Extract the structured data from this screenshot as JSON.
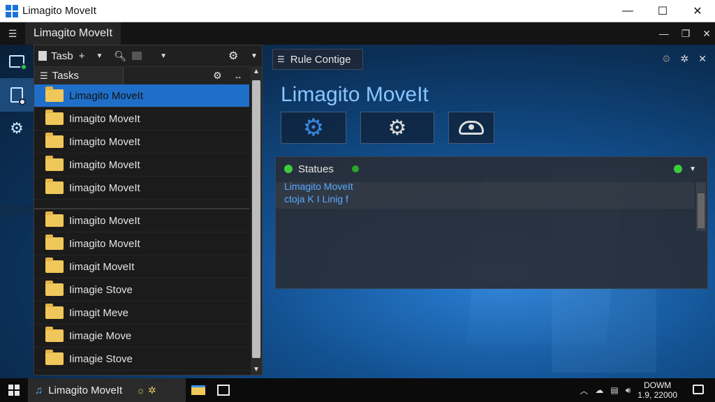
{
  "window": {
    "title": "Limagito MoveIt",
    "minimize": "—",
    "maximize": "☐",
    "close": "✕"
  },
  "app_header": {
    "menu_glyph": "☰",
    "tab_label": "Limagito MoveIt",
    "ctrl_min": "—",
    "ctrl_restore": "❐",
    "ctrl_close": "✕"
  },
  "toolbar": {
    "tasb_label": "Tasb",
    "plus": "+"
  },
  "tasks_panel": {
    "header": "Tasks",
    "items": [
      {
        "label": "Limagito MoveIt",
        "selected": true
      },
      {
        "label": "Iimagito MoveIt",
        "selected": false
      },
      {
        "label": "Iimagito MoveIt",
        "selected": false
      },
      {
        "label": "Iimagito MoveIt",
        "selected": false
      },
      {
        "label": "Iimagito MoveIt",
        "selected": false
      },
      {
        "label": "Iimagito MoveIt",
        "selected": false
      },
      {
        "label": "Iimagito MoveIt",
        "selected": false
      },
      {
        "label": "Iimagit MoveIt",
        "selected": false
      },
      {
        "label": "Iimagie Stove",
        "selected": false
      },
      {
        "label": "Iimagit Meve",
        "selected": false
      },
      {
        "label": "Iimagie Move",
        "selected": false
      },
      {
        "label": "Iimagie Stove",
        "selected": false
      }
    ]
  },
  "rule_config": {
    "tab_label": "Rule Contige",
    "title": "Limagito MoveIt",
    "status": {
      "header": "Statues",
      "line1": "Limagito MoveIt",
      "line2": "ctoja K I Linig f"
    }
  },
  "taskbar": {
    "app_label": "Limagito MoveIt",
    "clock_line1": "DOWM",
    "clock_line2": "1.9, 22000"
  },
  "colors": {
    "accent": "#1f6fc8",
    "title_blue": "#8ac6ff",
    "status_green": "#3ccc3c",
    "folder": "#f0c75a"
  }
}
